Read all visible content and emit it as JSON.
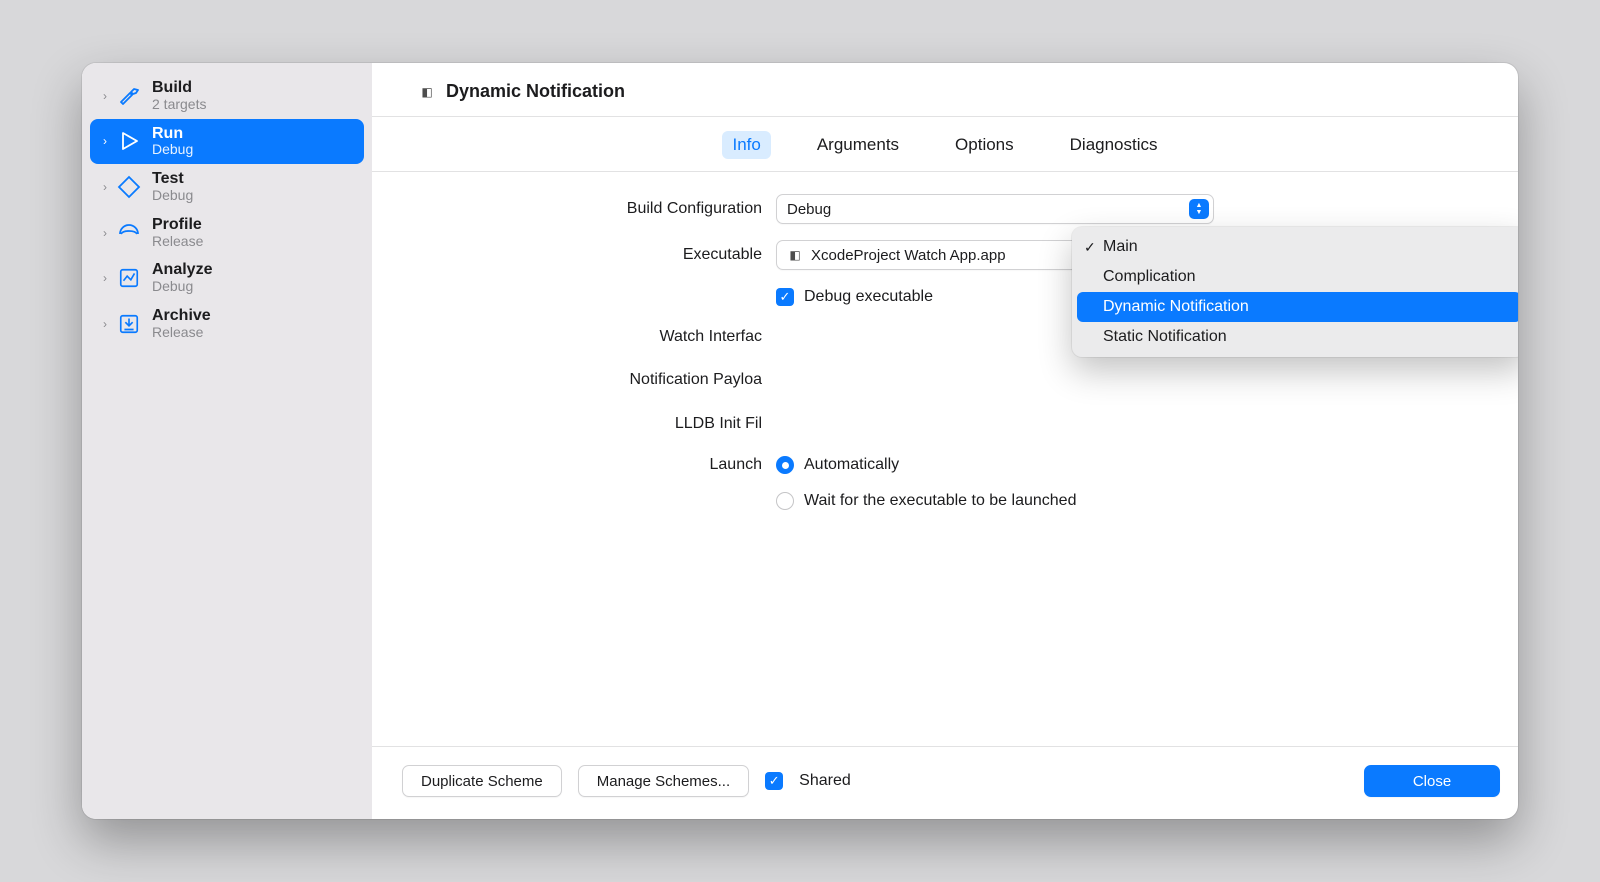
{
  "sidebar": {
    "items": [
      {
        "title": "Build",
        "subtitle": "2 targets"
      },
      {
        "title": "Run",
        "subtitle": "Debug"
      },
      {
        "title": "Test",
        "subtitle": "Debug"
      },
      {
        "title": "Profile",
        "subtitle": "Release"
      },
      {
        "title": "Analyze",
        "subtitle": "Debug"
      },
      {
        "title": "Archive",
        "subtitle": "Release"
      }
    ]
  },
  "header": {
    "title": "Dynamic Notification"
  },
  "tabs": {
    "info": "Info",
    "arguments": "Arguments",
    "options": "Options",
    "diagnostics": "Diagnostics"
  },
  "form": {
    "labels": {
      "build_configuration": "Build Configuration",
      "executable": "Executable",
      "watch_interface": "Watch Interfac",
      "notification_payload": "Notification Payloa",
      "lldb_init_file": "LLDB Init Fil",
      "launch": "Launch"
    },
    "values": {
      "build_configuration": "Debug",
      "executable": "XcodeProject Watch App.app",
      "debug_executable_label": "Debug executable",
      "launch_automatically": "Automatically",
      "launch_wait": "Wait for the executable to be launched"
    }
  },
  "dropdown": {
    "items": [
      {
        "label": "Main",
        "checked": true
      },
      {
        "label": "Complication",
        "checked": false
      },
      {
        "label": "Dynamic Notification",
        "checked": false,
        "highlight": true
      },
      {
        "label": "Static Notification",
        "checked": false
      }
    ]
  },
  "footer": {
    "duplicate": "Duplicate Scheme",
    "manage": "Manage Schemes...",
    "shared": "Shared",
    "close": "Close"
  }
}
